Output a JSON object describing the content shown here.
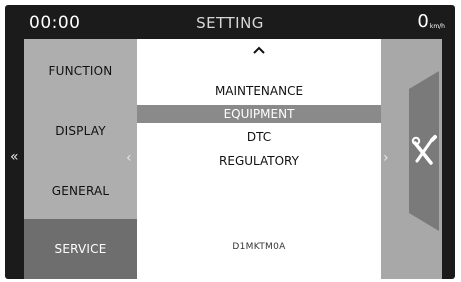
{
  "status": {
    "clock": "00:00",
    "title": "SETTING",
    "speed_value": "0",
    "speed_unit": "km/h"
  },
  "menu": [
    {
      "label": "FUNCTION"
    },
    {
      "label": "DISPLAY"
    },
    {
      "label": "GENERAL"
    },
    {
      "label": "SERVICE",
      "active": true
    }
  ],
  "list": {
    "items": [
      {
        "label": "MAINTENANCE"
      },
      {
        "label": "EQUIPMENT",
        "selected": true
      },
      {
        "label": "DTC"
      },
      {
        "label": "REGULATORY"
      }
    ],
    "code": "D1MKTM0A"
  },
  "icons": {
    "scroll_up": "chevron-up-icon",
    "left_double": "double-chevron-left-icon",
    "left": "chevron-left-icon",
    "right": "chevron-right-icon",
    "tools": "wrench-screwdriver-icon"
  },
  "colors": {
    "frame": "#1b1b1b",
    "left_panel": "#aeaeae",
    "active_menu": "#6e6e6e",
    "selected_row": "#8a8a8a",
    "right_panel": "#a8a8a8",
    "tab": "#7a7a7a"
  }
}
